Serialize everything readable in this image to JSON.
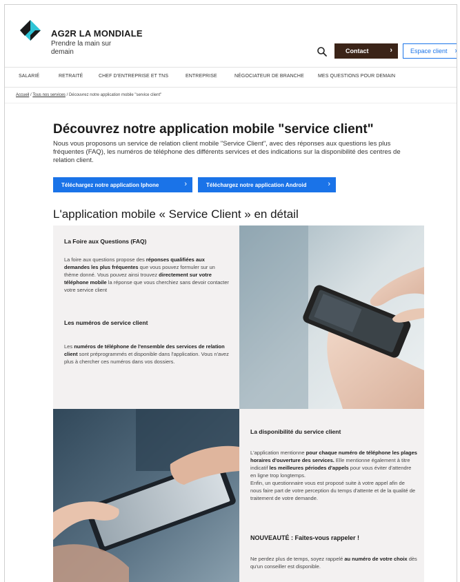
{
  "header": {
    "brand": "AG2R LA MONDIALE",
    "tagline": "Prendre la main sur demain",
    "contact_label": "Contact",
    "espace_label": "Espace client"
  },
  "nav": {
    "items": [
      "SALARIÉ",
      "RETRAITÉ",
      "CHEF D'ENTREPRISE ET TNS",
      "ENTREPRISE",
      "NÉGOCIATEUR DE BRANCHE",
      "MES QUESTIONS POUR DEMAIN"
    ]
  },
  "breadcrumb": {
    "home": "Accueil",
    "sep": " / ",
    "services": "Tous nos services",
    "current": "Découvrez notre application mobile \"service client\""
  },
  "main": {
    "title": "Découvrez notre application mobile \"service client\"",
    "intro": "Nous vous proposons un service de relation client mobile \"Service Client\", avec des réponses aux questions les plus fréquentes (FAQ), les numéros de téléphone des différents services et des indications sur la disponibilité des centres de relation client.",
    "btn_iphone": "Téléchargez notre application Iphone",
    "btn_android": "Téléchargez notre application Android",
    "subtitle": "L'application mobile « Service Client » en détail"
  },
  "sections": {
    "faq": {
      "title": "La Foire aux Questions (FAQ)",
      "text": [
        {
          "t": "La foire aux questions propose des ",
          "b": false
        },
        {
          "t": "réponses qualifiées aux demandes les plus fréquentes",
          "b": true
        },
        {
          "t": " que vous pouvez formuler sur un thème donné. Vous pouvez ainsi trouvez ",
          "b": false
        },
        {
          "t": "directement sur votre téléphone mobile",
          "b": true
        },
        {
          "t": " la réponse que vous cherchiez sans devoir contacter votre service client",
          "b": false
        }
      ]
    },
    "numbers": {
      "title": "Les numéros de service client",
      "text": [
        {
          "t": "Les ",
          "b": false
        },
        {
          "t": "numéros de téléphone de l'ensemble des services de relation client",
          "b": true
        },
        {
          "t": " sont préprogrammés et disponible dans l'application. Vous n'avez plus à chercher ces numéros dans vos dossiers.",
          "b": false
        }
      ]
    },
    "availability": {
      "title": "La disponibilité du service client",
      "text": [
        {
          "t": "L'application mentionne ",
          "b": false
        },
        {
          "t": "pour chaque numéro de téléphone les plages horaires d'ouverture des services.",
          "b": true
        },
        {
          "t": " Elle mentionne également à titre indicatif ",
          "b": false
        },
        {
          "t": "les meilleures périodes d'appels",
          "b": true
        },
        {
          "t": " pour vous éviter d'attendre en ligne trop longtemps.",
          "b": false
        },
        {
          "t": "\nEnfin, un questionnaire vous est proposé suite à votre appel afin de nous faire part de votre perception du temps d'attente et de la qualité de traitement de votre demande.",
          "b": false
        }
      ]
    },
    "callback": {
      "title": "NOUVEAUTÉ : Faites-vous rappeler !",
      "text": [
        {
          "t": "Ne perdez plus de temps, soyez rappelé ",
          "b": false
        },
        {
          "t": "au numéro de votre choix",
          "b": true
        },
        {
          "t": " dès qu'un conseiller est disponible.",
          "b": false
        }
      ]
    }
  },
  "icons": [
    "logo-mark",
    "search-icon",
    "chevron-right-icon"
  ],
  "colors": {
    "primary_blue": "#1a73e8",
    "contact_brown": "#3b2418",
    "logo_cyan": "#2ec4d6"
  }
}
